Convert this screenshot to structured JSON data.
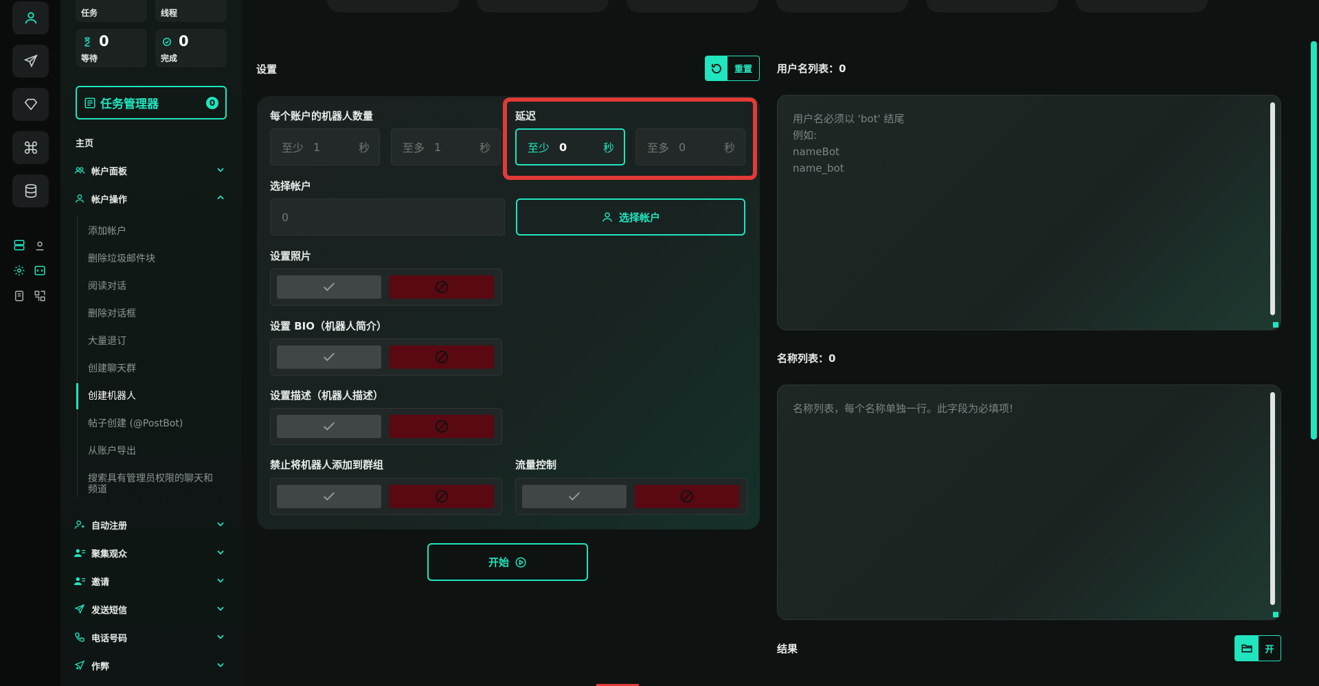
{
  "stats": [
    {
      "icon": "list-icon",
      "value": "",
      "label": "任务"
    },
    {
      "icon": "thread-icon",
      "value": "",
      "label": "线程"
    },
    {
      "icon": "hourglass-icon",
      "value": "0",
      "label": "等待"
    },
    {
      "icon": "check-circle-icon",
      "value": "0",
      "label": "完成"
    }
  ],
  "task_manager": {
    "label": "任务管理器",
    "count": "0"
  },
  "sidebar": {
    "home_title": "主页",
    "account_panel": "帐户面板",
    "account_ops": "帐户操作",
    "sub_items": [
      "添加帐户",
      "删除垃圾邮件块",
      "阅读对话",
      "删除对话框",
      "大量退订",
      "创建聊天群",
      "创建机器人",
      "帖子创建 (@PostBot)",
      "从账户导出",
      "搜索具有管理员权限的聊天和频道"
    ],
    "active_sub_index": 6,
    "groups": [
      "自动注册",
      "聚集观众",
      "邀请",
      "发送短信",
      "电话号码",
      "作弊"
    ]
  },
  "settings": {
    "title": "设置",
    "reset_label": "重置",
    "bots_per_account": {
      "label": "每个账户的机器人数量",
      "min_prefix": "至少",
      "min_value": "1",
      "max_prefix": "至多",
      "max_value": "1",
      "unit": "秒"
    },
    "delay": {
      "label": "延迟",
      "min_prefix": "至少",
      "min_value": "0",
      "max_prefix": "至多",
      "max_value": "0",
      "unit": "秒"
    },
    "select_account": {
      "label": "选择帐户",
      "value": "0",
      "button_label": "选择帐户"
    },
    "set_photo": "设置照片",
    "set_bio": "设置 BIO（机器人简介）",
    "set_description": "设置描述（机器人描述）",
    "forbid_add_to_groups": "禁止将机器人添加到群组",
    "traffic_control": "流量控制",
    "start_label": "开始"
  },
  "usernames": {
    "title": "用户名列表：0",
    "placeholder_lines": [
      "用户名必须以 'bot' 结尾",
      "例如:",
      "nameBot",
      "name_bot"
    ]
  },
  "names": {
    "title": "名称列表：0",
    "placeholder": "名称列表，每个名称单独一行。此字段为必填项!"
  },
  "results": {
    "title": "结果",
    "open_label": "开"
  },
  "colors": {
    "accent": "#21e5bf",
    "danger": "#5a0812",
    "highlight": "#e23a36"
  }
}
